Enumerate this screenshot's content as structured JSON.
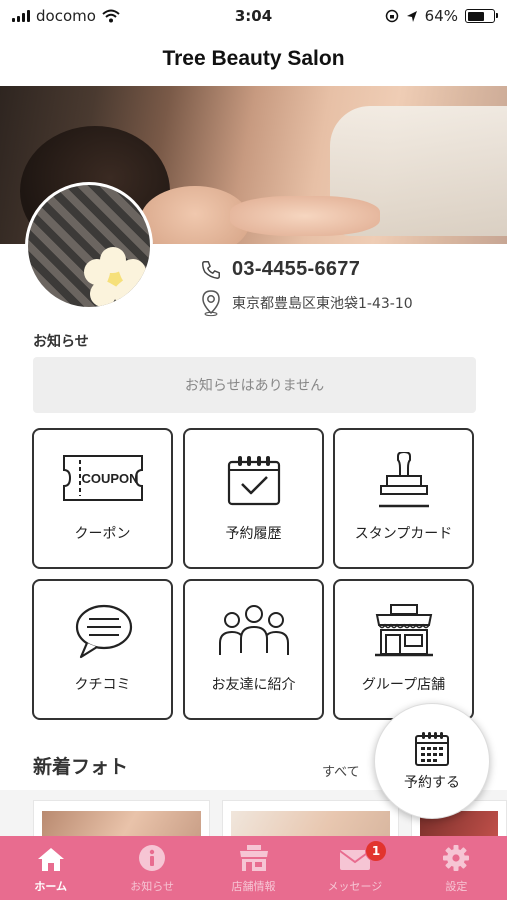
{
  "status_bar": {
    "carrier": "docomo",
    "time": "3:04",
    "battery_percent": "64%",
    "battery_level": 0.64,
    "icons": [
      "signal-icon",
      "wifi-icon",
      "rotation-lock-icon",
      "location-icon",
      "battery-icon"
    ]
  },
  "header": {
    "title": "Tree Beauty Salon"
  },
  "shop": {
    "phone": "03-4455-6677",
    "address": "東京都豊島区東池袋1-43-10"
  },
  "notice": {
    "heading": "お知らせ",
    "empty_message": "お知らせはありません"
  },
  "menu": {
    "tiles": [
      {
        "label": "クーポン",
        "icon": "coupon-icon",
        "coupon_text": "COUPON"
      },
      {
        "label": "予約履歴",
        "icon": "calendar-check-icon"
      },
      {
        "label": "スタンプカード",
        "icon": "stamp-icon"
      },
      {
        "label": "クチコミ",
        "icon": "speech-bubble-icon"
      },
      {
        "label": "お友達に紹介",
        "icon": "people-icon"
      },
      {
        "label": "グループ店舗",
        "icon": "storefront-icon"
      }
    ]
  },
  "photos": {
    "title": "新着フォト",
    "see_all": "すべて"
  },
  "fab": {
    "label": "予約する",
    "icon": "calendar-icon"
  },
  "tab_bar": {
    "accent_color": "#e86c8f",
    "items": [
      {
        "label": "ホーム",
        "icon": "home-icon",
        "active": true
      },
      {
        "label": "お知らせ",
        "icon": "info-icon",
        "active": false
      },
      {
        "label": "店舗情報",
        "icon": "shop-icon",
        "active": false
      },
      {
        "label": "メッセージ",
        "icon": "mail-icon",
        "active": false,
        "badge": "1"
      },
      {
        "label": "設定",
        "icon": "gear-icon",
        "active": false
      }
    ]
  }
}
